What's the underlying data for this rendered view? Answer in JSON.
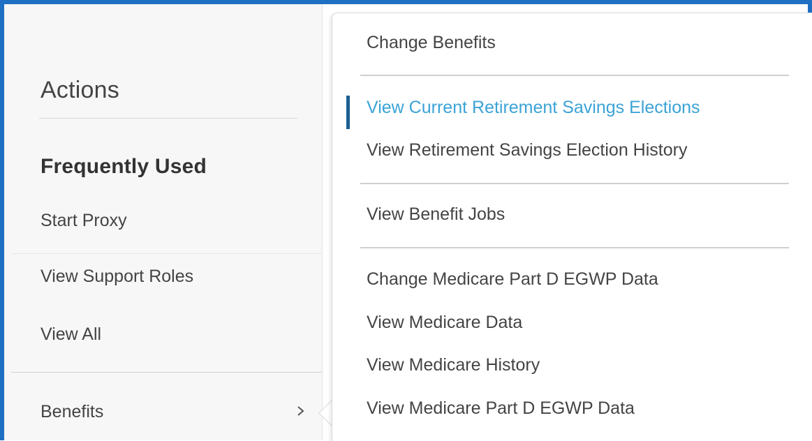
{
  "actions": {
    "title": "Actions",
    "frequently_used_heading": "Frequently Used",
    "items": [
      {
        "label": "Start Proxy"
      },
      {
        "label": "View Support Roles"
      },
      {
        "label": "View All"
      }
    ],
    "category": {
      "label": "Benefits",
      "icon": "chevron-right-icon"
    }
  },
  "submenu": {
    "groups": [
      [
        {
          "label": "Change Benefits"
        }
      ],
      [
        {
          "label": "View Current Retirement Savings Elections",
          "active": true
        },
        {
          "label": "View Retirement Savings Election History"
        }
      ],
      [
        {
          "label": "View Benefit Jobs"
        }
      ],
      [
        {
          "label": "Change Medicare Part D EGWP Data"
        },
        {
          "label": "View Medicare Data"
        },
        {
          "label": "View Medicare History"
        },
        {
          "label": "View Medicare Part D EGWP Data"
        }
      ]
    ]
  },
  "colors": {
    "frame_border": "#1f6fc3",
    "active_text": "#3ba3d6",
    "active_indicator": "#1d5f92",
    "text": "#444444"
  }
}
